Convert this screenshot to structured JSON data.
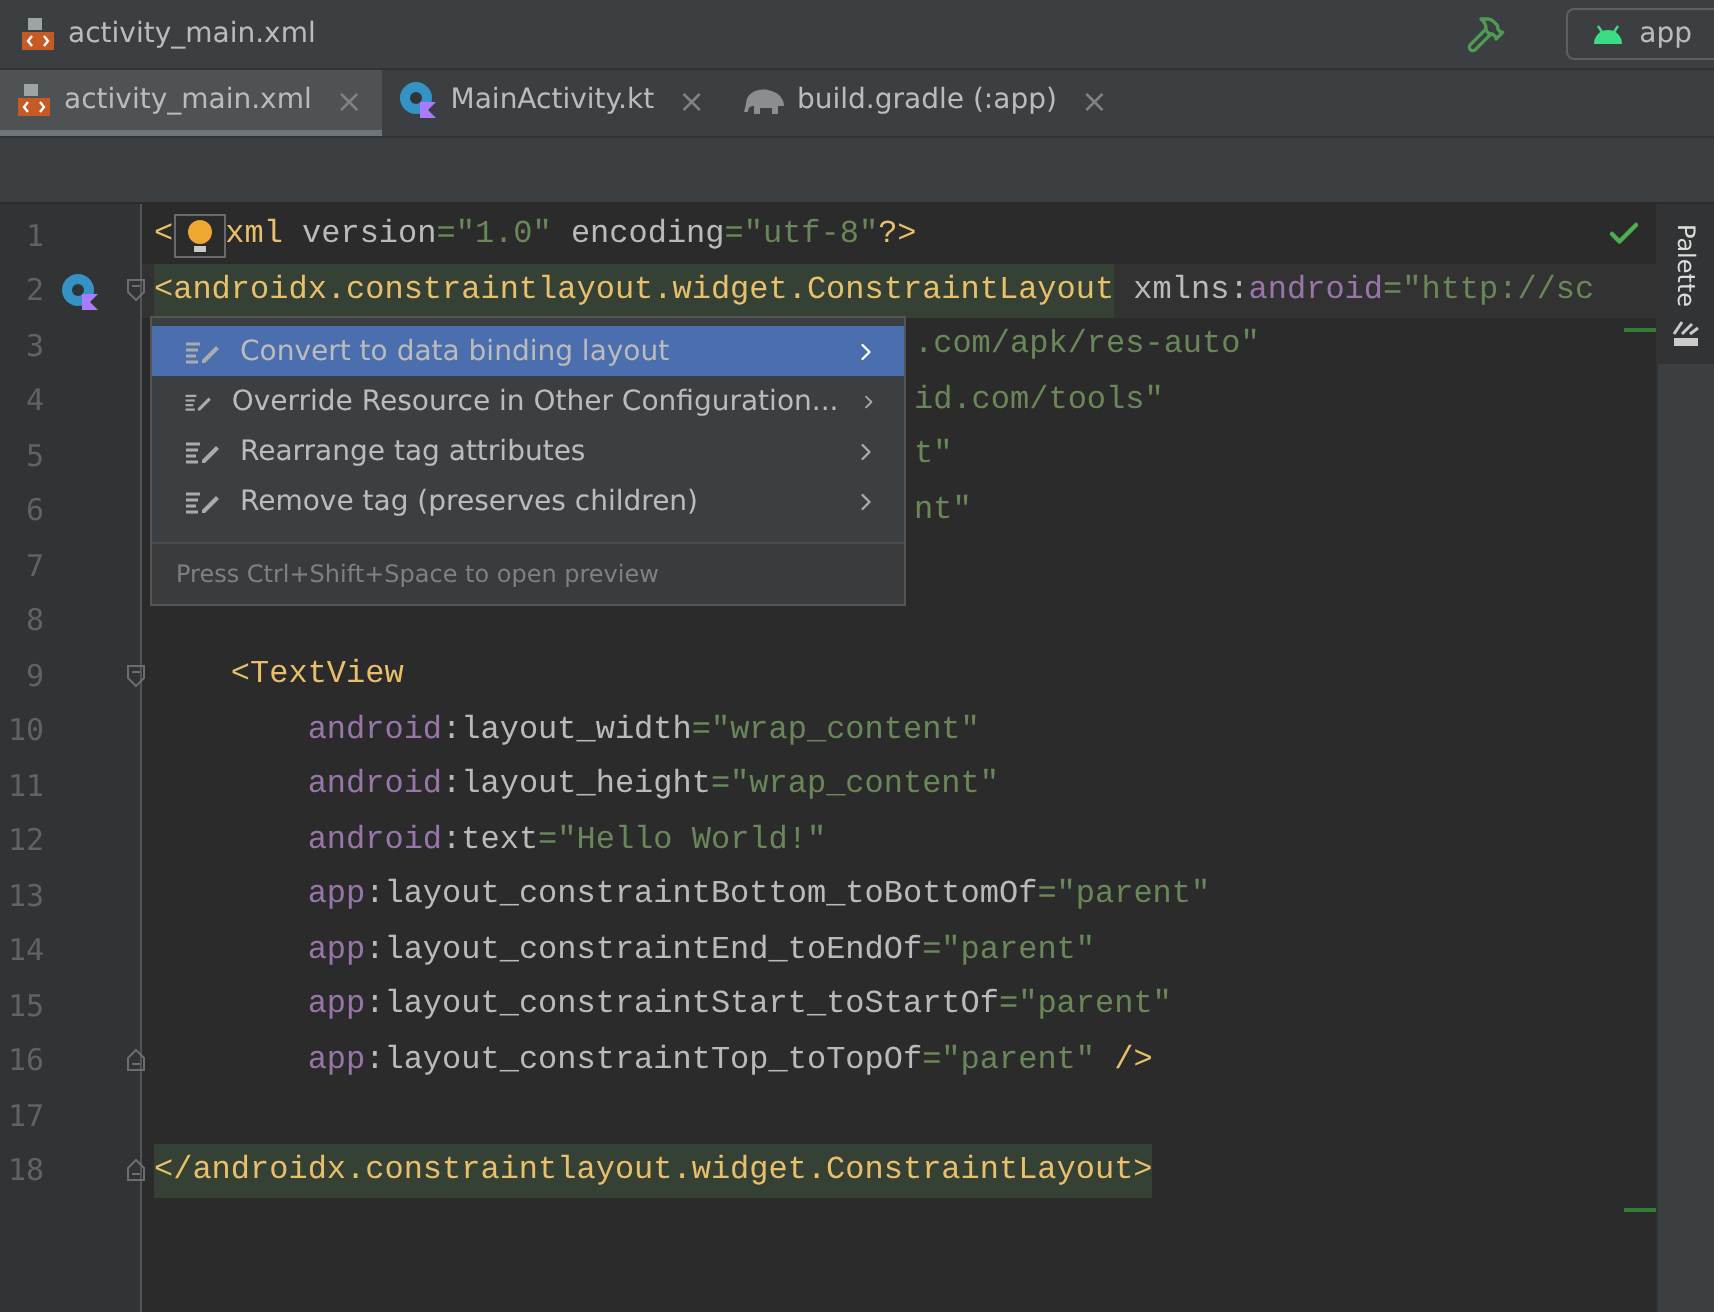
{
  "breadcrumb": {
    "file": "activity_main.xml"
  },
  "run_config": {
    "label": "app"
  },
  "tabs": [
    {
      "label": "activity_main.xml",
      "kind": "xml",
      "selected": true,
      "close": "×"
    },
    {
      "label": "MainActivity.kt",
      "kind": "kotlin",
      "selected": false,
      "close": "×"
    },
    {
      "label": "build.gradle (:app)",
      "kind": "gradle",
      "selected": false,
      "close": "×"
    }
  ],
  "editor": {
    "lines": [
      {
        "number": "1",
        "bulb": true,
        "tokens": [
          {
            "kind": "tag",
            "text": "<"
          },
          {
            "kind": "tag",
            "text": "xml"
          },
          {
            "kind": "text",
            "text": " version"
          },
          {
            "kind": "string",
            "text": "=\"1.0\""
          },
          {
            "kind": "text",
            "text": " encoding"
          },
          {
            "kind": "string",
            "text": "=\"utf-8\""
          },
          {
            "kind": "tag",
            "text": "?>"
          }
        ]
      },
      {
        "number": "2",
        "fold_open": true,
        "current": true,
        "gutter_icon": true,
        "tokens": [
          {
            "kind": "tag",
            "text": "<androidx.constraintlayout.widget.ConstraintLayout",
            "matched": true
          },
          {
            "kind": "text",
            "text": " xmlns:"
          },
          {
            "kind": "ns",
            "text": "android"
          },
          {
            "kind": "string",
            "text": "=\"http://sc"
          }
        ]
      },
      {
        "number": "3",
        "covered": true,
        "tokens": [
          {
            "kind": "string",
            "text": ".com/apk/res-auto\""
          }
        ]
      },
      {
        "number": "4",
        "covered": true,
        "tokens": [
          {
            "kind": "string",
            "text": "id.com/tools\""
          }
        ]
      },
      {
        "number": "5",
        "covered": true,
        "tokens": [
          {
            "kind": "string",
            "text": "t\""
          }
        ]
      },
      {
        "number": "6",
        "covered": true,
        "tokens": [
          {
            "kind": "string",
            "text": "nt\""
          }
        ]
      },
      {
        "number": "7"
      },
      {
        "number": "8"
      },
      {
        "number": "9",
        "fold_open": true,
        "tokens": [
          {
            "kind": "tag",
            "text": "    <TextView"
          }
        ]
      },
      {
        "number": "10",
        "tokens": [
          {
            "kind": "ns",
            "text": "        android"
          },
          {
            "kind": "text",
            "text": ":layout_width"
          },
          {
            "kind": "string",
            "text": "=\"wrap_content\""
          }
        ]
      },
      {
        "number": "11",
        "tokens": [
          {
            "kind": "ns",
            "text": "        android"
          },
          {
            "kind": "text",
            "text": ":layout_height"
          },
          {
            "kind": "string",
            "text": "=\"wrap_content\""
          }
        ]
      },
      {
        "number": "12",
        "tokens": [
          {
            "kind": "ns",
            "text": "        android"
          },
          {
            "kind": "text",
            "text": ":text"
          },
          {
            "kind": "string",
            "text": "=\"Hello World!\""
          }
        ]
      },
      {
        "number": "13",
        "tokens": [
          {
            "kind": "ns",
            "text": "        app"
          },
          {
            "kind": "text",
            "text": ":layout_constraintBottom_toBottomOf"
          },
          {
            "kind": "string",
            "text": "=\"parent\""
          }
        ]
      },
      {
        "number": "14",
        "tokens": [
          {
            "kind": "ns",
            "text": "        app"
          },
          {
            "kind": "text",
            "text": ":layout_constraintEnd_toEndOf"
          },
          {
            "kind": "string",
            "text": "=\"parent\""
          }
        ]
      },
      {
        "number": "15",
        "tokens": [
          {
            "kind": "ns",
            "text": "        app"
          },
          {
            "kind": "text",
            "text": ":layout_constraintStart_toStartOf"
          },
          {
            "kind": "string",
            "text": "=\"parent\""
          }
        ]
      },
      {
        "number": "16",
        "fold_close": true,
        "tokens": [
          {
            "kind": "ns",
            "text": "        app"
          },
          {
            "kind": "text",
            "text": ":layout_constraintTop_toTopOf"
          },
          {
            "kind": "string",
            "text": "=\"parent\""
          },
          {
            "kind": "tag",
            "text": " />"
          }
        ]
      },
      {
        "number": "17"
      },
      {
        "number": "18",
        "fold_close": true,
        "tokens": [
          {
            "kind": "tag",
            "text": "</androidx.constraintlayout.widget.ConstraintLayout>",
            "matched": true
          }
        ]
      }
    ]
  },
  "intention_menu": {
    "items": [
      {
        "label": "Convert to data binding layout",
        "selected": true
      },
      {
        "label": "Override Resource in Other Configuration...",
        "selected": false
      },
      {
        "label": "Rearrange tag attributes",
        "selected": false
      },
      {
        "label": "Remove tag (preserves children)",
        "selected": false
      }
    ],
    "hint": "Press Ctrl+Shift+Space to open preview"
  },
  "side_panel": {
    "tab": "Palette"
  }
}
